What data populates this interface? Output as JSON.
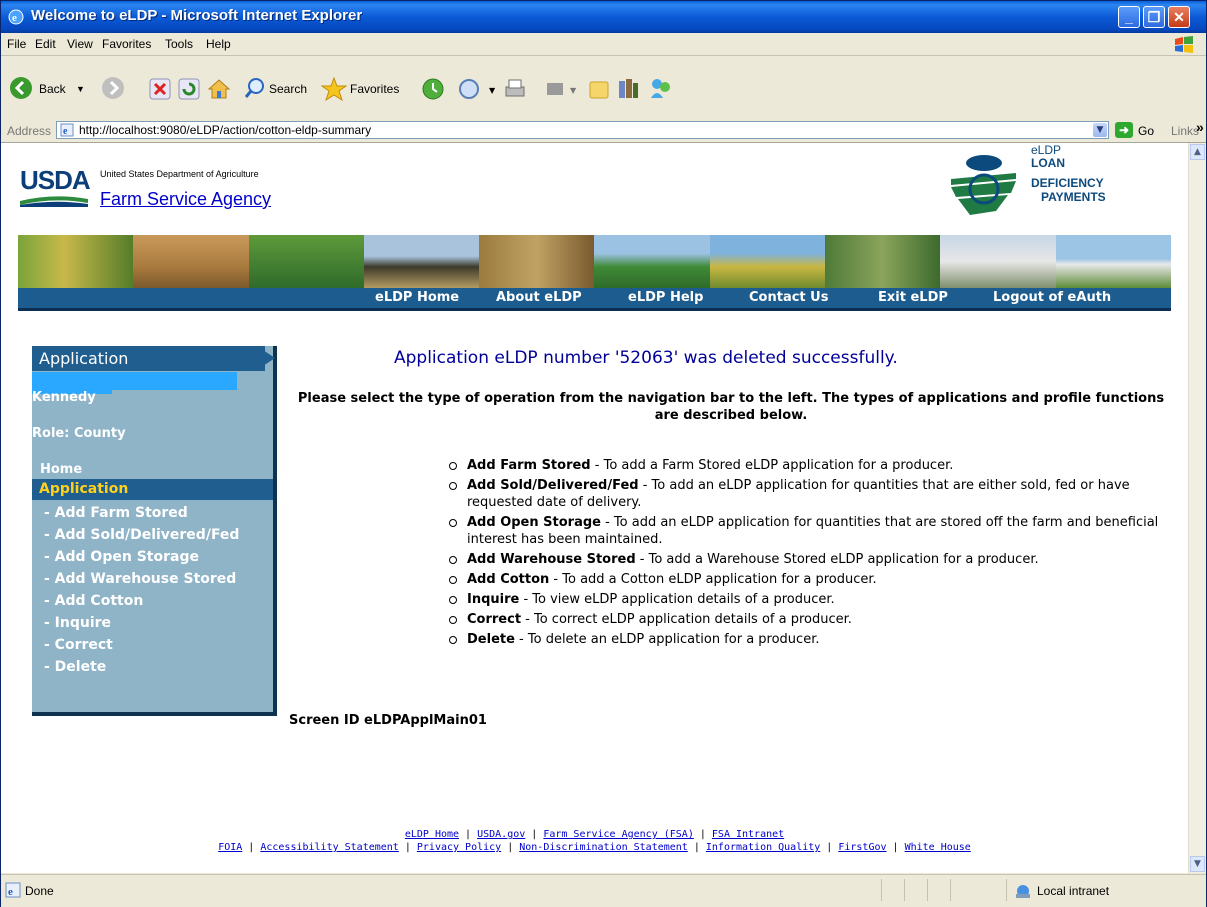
{
  "window": {
    "title": "Welcome to eLDP - Microsoft Internet Explorer"
  },
  "menu": [
    "File",
    "Edit",
    "View",
    "Favorites",
    "Tools",
    "Help"
  ],
  "toolbar": {
    "back": "Back",
    "search": "Search",
    "favorites": "Favorites"
  },
  "address": {
    "label": "Address",
    "url": "http://localhost:9080/eLDP/action/cotton-eldp-summary",
    "go": "Go",
    "links": "Links"
  },
  "banner": {
    "usda": "USDA",
    "dept": "United States Department of Agriculture",
    "agency": "Farm Service Agency",
    "eldp_line1": "eLDP",
    "eldp_line2": "LOAN",
    "eldp_line3": "DEFICIENCY",
    "eldp_line4": "PAYMENTS"
  },
  "nav": [
    "eLDP Home",
    "About eLDP",
    "eLDP Help",
    "Contact Us",
    "Exit eLDP",
    "Logout of eAuth"
  ],
  "sidebar": {
    "title": "Application",
    "user_name": "Kennedy",
    "role": "Role: County",
    "home": "Home",
    "active": "Application",
    "items": [
      "- Add Farm Stored",
      "- Add Sold/Delivered/Fed",
      "- Add Open Storage",
      "- Add Warehouse Stored",
      "- Add Cotton",
      "- Inquire",
      "- Correct",
      "- Delete"
    ]
  },
  "main": {
    "message": "Application eLDP number '52063' was deleted successfully.",
    "intro": "Please select the type of operation from the navigation bar to the left. The types of applications and profile functions are described below.",
    "operations": [
      {
        "name": "Add Farm Stored",
        "desc": " - To add a Farm Stored eLDP application for a producer."
      },
      {
        "name": "Add Sold/Delivered/Fed",
        "desc": " - To add an eLDP application for quantities that are either sold, fed or have requested date of delivery."
      },
      {
        "name": "Add Open Storage",
        "desc": " - To add an eLDP application for quantities that are stored off the farm and beneficial interest has been maintained."
      },
      {
        "name": "Add Warehouse Stored",
        "desc": " - To add a Warehouse Stored eLDP application for a producer."
      },
      {
        "name": "Add Cotton",
        "desc": " - To add a Cotton eLDP application for a producer."
      },
      {
        "name": "Inquire",
        "desc": " - To view eLDP application details of a producer."
      },
      {
        "name": "Correct",
        "desc": " - To correct eLDP application details of a producer."
      },
      {
        "name": "Delete",
        "desc": " - To delete an eLDP application for a producer."
      }
    ],
    "screen_id": "Screen ID eLDPApplMain01"
  },
  "footer": {
    "row1": [
      "eLDP Home",
      "USDA.gov",
      "Farm Service Agency (FSA)",
      "FSA Intranet"
    ],
    "row2": [
      "FOIA",
      "Accessibility Statement",
      "Privacy Policy",
      "Non-Discrimination Statement",
      "Information Quality",
      "FirstGov",
      "White House"
    ],
    "sep": " | "
  },
  "status": {
    "text": "Done",
    "zone": "Local intranet"
  },
  "colors": {
    "nav_bar": "#1d5c8e",
    "sidebar": "#8fb3c7",
    "message": "#000099",
    "active_item": "#ffd11a"
  }
}
